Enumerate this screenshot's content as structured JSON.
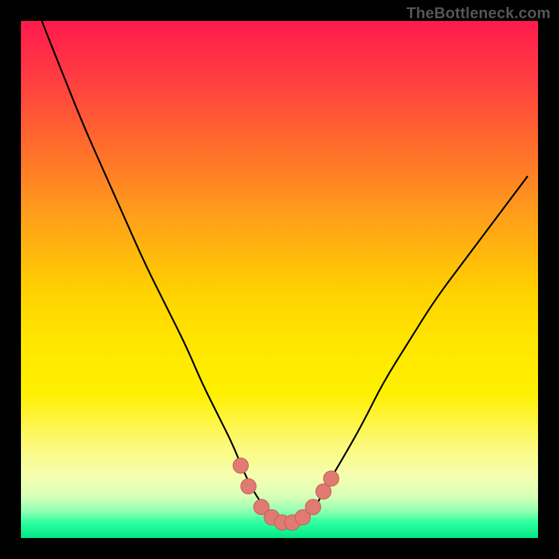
{
  "watermark": "TheBottleneck.com",
  "colors": {
    "background": "#000000",
    "curve": "#000000",
    "marker_fill": "#e07a72",
    "marker_stroke": "#c45a52",
    "gradient_top": "#ff1a4d",
    "gradient_bottom": "#00e886"
  },
  "chart_data": {
    "type": "line",
    "title": "",
    "xlabel": "",
    "ylabel": "",
    "xlim": [
      0,
      100
    ],
    "ylim": [
      0,
      100
    ],
    "grid": false,
    "legend": false,
    "annotations": [],
    "series": [
      {
        "name": "curve",
        "x": [
          0,
          4,
          8,
          12,
          16,
          20,
          24,
          28,
          32,
          35,
          38,
          41,
          43,
          45,
          47,
          49,
          51,
          53,
          55,
          57,
          59,
          62,
          66,
          70,
          75,
          80,
          86,
          92,
          98
        ],
        "values": [
          111,
          100,
          90,
          80,
          71,
          62,
          53,
          45,
          37,
          30,
          24,
          18,
          13,
          9,
          6,
          4,
          3,
          3,
          4,
          6,
          10,
          15,
          22,
          30,
          38,
          46,
          54,
          62,
          70
        ]
      }
    ],
    "markers": [
      {
        "x": 42.5,
        "y": 14
      },
      {
        "x": 44.0,
        "y": 10
      },
      {
        "x": 46.5,
        "y": 6
      },
      {
        "x": 48.5,
        "y": 4
      },
      {
        "x": 50.5,
        "y": 3
      },
      {
        "x": 52.5,
        "y": 3
      },
      {
        "x": 54.5,
        "y": 4
      },
      {
        "x": 56.5,
        "y": 6
      },
      {
        "x": 58.5,
        "y": 9
      },
      {
        "x": 60.0,
        "y": 11.5
      }
    ],
    "marker_radius": 11
  }
}
